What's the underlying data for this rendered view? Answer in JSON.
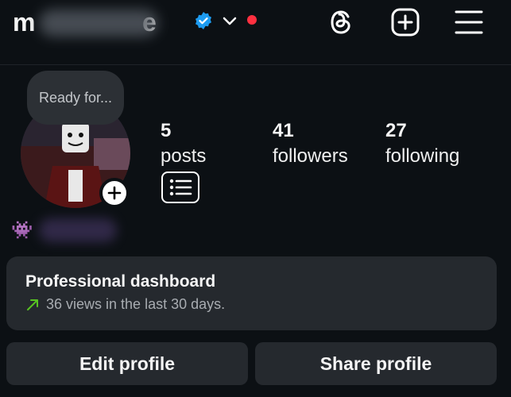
{
  "header": {
    "username_initial": "m",
    "username_trailing": "e",
    "icons": [
      "verified-badge-icon",
      "chevron-down-icon",
      "notification-dot",
      "threads-icon",
      "create-icon",
      "menu-icon"
    ],
    "colors": {
      "verified": "#1d9bf0",
      "notification": "#ff3040"
    }
  },
  "profile": {
    "story_note": "Ready for...",
    "stats": [
      {
        "value": "5",
        "label": "posts"
      },
      {
        "value": "41",
        "label": "followers"
      },
      {
        "value": "27",
        "label": "following"
      }
    ],
    "name_emoji": "👾"
  },
  "dashboard": {
    "title": "Professional dashboard",
    "subtitle": "36 views in the last 30 days.",
    "trend_color": "#58c322"
  },
  "actions": {
    "edit_label": "Edit profile",
    "share_label": "Share profile"
  }
}
